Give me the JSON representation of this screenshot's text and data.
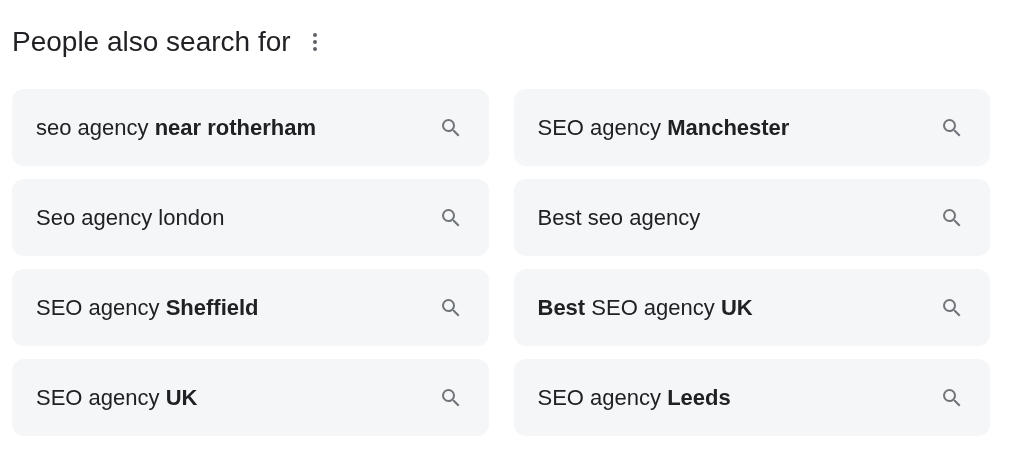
{
  "title": "People also search for",
  "suggestions": [
    "seo agency **near rotherham**",
    "SEO agency **Manchester**",
    "Seo agency london",
    "Best seo agency",
    "SEO agency **Sheffield**",
    "**Best** SEO agency **UK**",
    "SEO agency **UK**",
    "SEO agency **Leeds**"
  ]
}
